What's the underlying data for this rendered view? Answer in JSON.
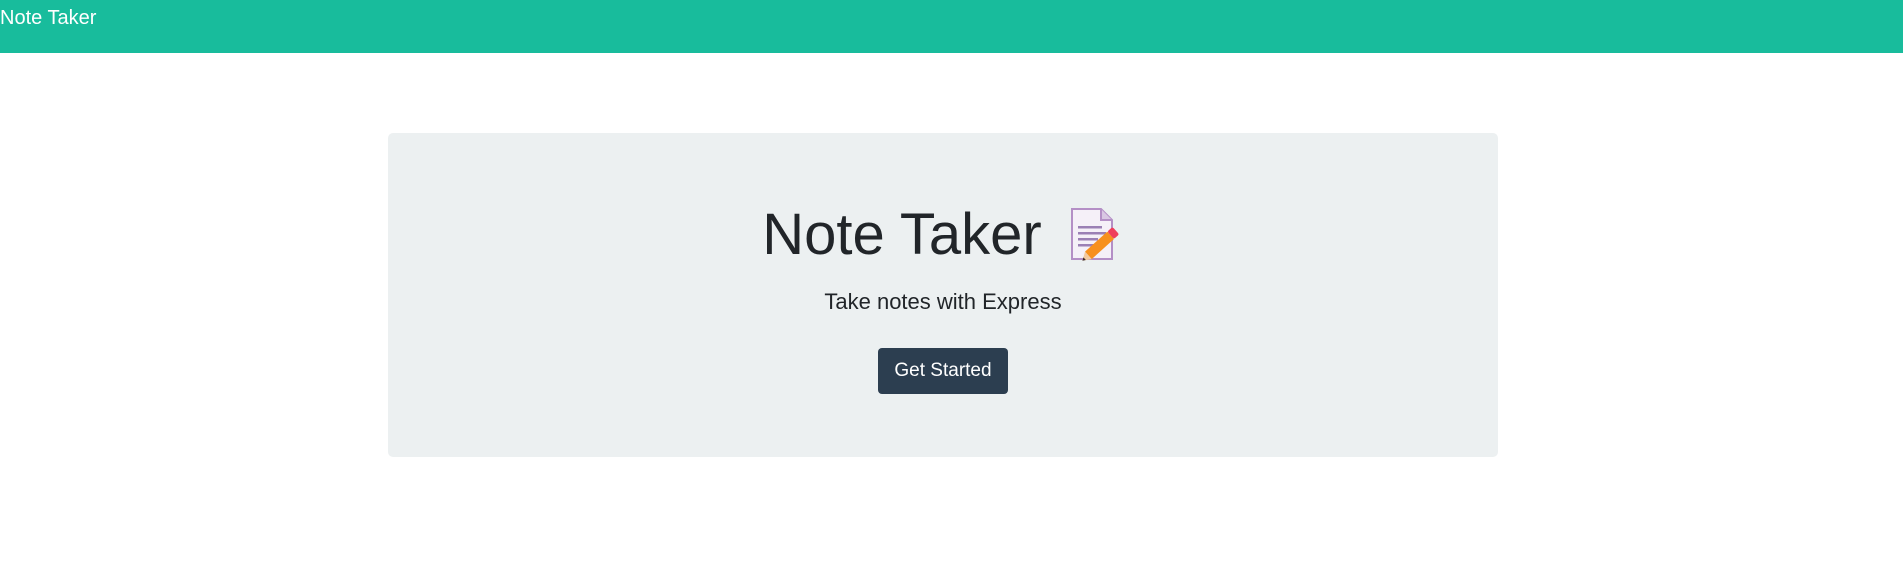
{
  "navbar": {
    "brand": "Note Taker",
    "background": "#18bc9c"
  },
  "hero": {
    "title": "Note Taker",
    "icon": "memo-pencil-icon",
    "lead": "Take notes with Express",
    "button_label": "Get Started",
    "button_color": "#2c3e50",
    "panel_color": "#ecf0f1"
  }
}
